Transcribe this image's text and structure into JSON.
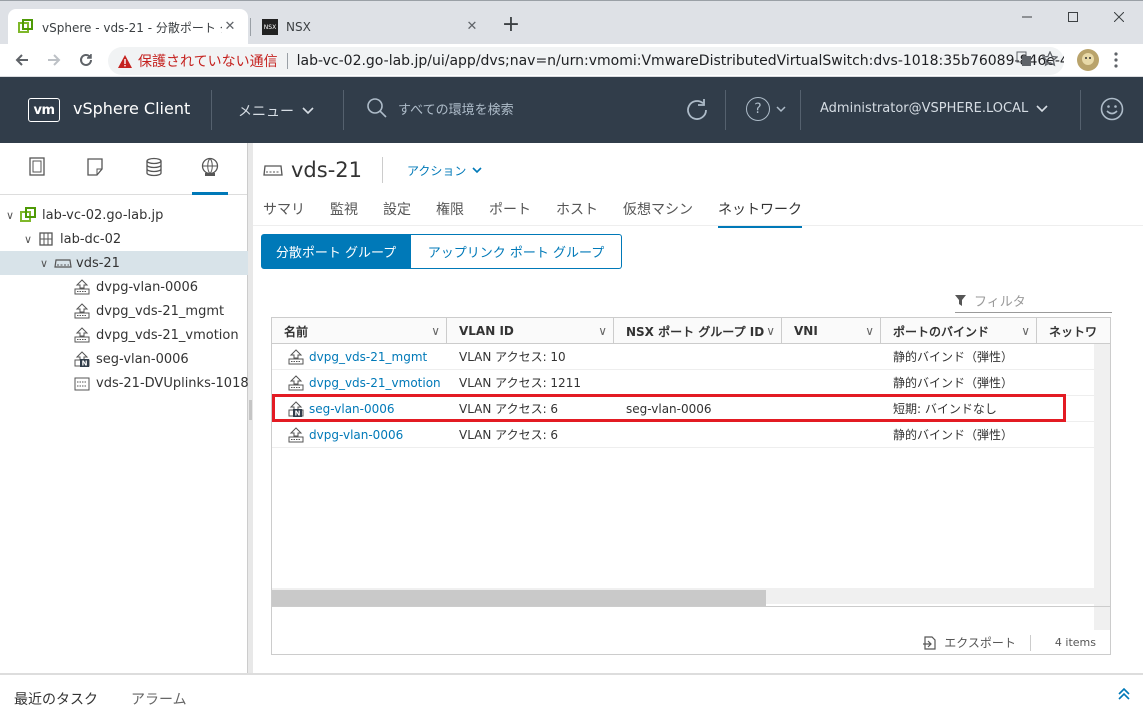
{
  "browser": {
    "tabs": [
      {
        "title": "vSphere - vds-21 - 分散ポート グル",
        "close": "✕"
      },
      {
        "title": "NSX",
        "close": "✕",
        "favicon_text": "NSX"
      }
    ],
    "new_tab": "+",
    "security_warning": "保護されていない通信",
    "url": "lab-vc-02.go-lab.jp/ui/app/dvs;nav=n/urn:vmomi:VmwareDistributedVirtualSwitch:dvs-1018:35b76089-846e-41ef..."
  },
  "header": {
    "logo": "vm",
    "app_title": "vSphere Client",
    "menu_label": "メニュー",
    "search_placeholder": "すべての環境を検索",
    "help_label": "?",
    "user": "Administrator@VSPHERE.LOCAL"
  },
  "nav": {
    "tree": [
      {
        "label": "lab-vc-02.go-lab.jp",
        "icon": "vcenter-icon"
      },
      {
        "label": "lab-dc-02",
        "icon": "datacenter-icon"
      },
      {
        "label": "vds-21",
        "icon": "dvswitch-icon"
      },
      {
        "label": "dvpg-vlan-0006",
        "icon": "portgroup-icon"
      },
      {
        "label": "dvpg_vds-21_mgmt",
        "icon": "portgroup-icon"
      },
      {
        "label": "dvpg_vds-21_vmotion",
        "icon": "portgroup-icon"
      },
      {
        "label": "seg-vlan-0006",
        "icon": "nsx-portgroup-icon"
      },
      {
        "label": "vds-21-DVUplinks-1018",
        "icon": "uplink-portgroup-icon"
      }
    ]
  },
  "main": {
    "object_title": "vds-21",
    "actions_label": "アクション",
    "tabs": [
      "サマリ",
      "監視",
      "設定",
      "権限",
      "ポート",
      "ホスト",
      "仮想マシン",
      "ネットワーク"
    ],
    "active_tab": "ネットワーク",
    "subtabs": [
      "分散ポート グループ",
      "アップリンク ポート グループ"
    ],
    "filter_placeholder": "フィルタ",
    "columns": [
      "名前",
      "VLAN ID",
      "NSX ポート グループ ID",
      "VNI",
      "ポートのバインド",
      "ネットワ"
    ],
    "rows": [
      {
        "name": "dvpg_vds-21_mgmt",
        "vlan": "VLAN アクセス: 10",
        "nsx_id": "",
        "vni": "",
        "binding": "静的バインド（弾性）",
        "icon": "portgroup-icon"
      },
      {
        "name": "dvpg_vds-21_vmotion",
        "vlan": "VLAN アクセス: 1211",
        "nsx_id": "",
        "vni": "",
        "binding": "静的バインド（弾性）",
        "icon": "portgroup-icon"
      },
      {
        "name": "seg-vlan-0006",
        "vlan": "VLAN アクセス: 6",
        "nsx_id": "seg-vlan-0006",
        "vni": "",
        "binding": "短期: バインドなし",
        "icon": "nsx-portgroup-icon"
      },
      {
        "name": "dvpg-vlan-0006",
        "vlan": "VLAN アクセス: 6",
        "nsx_id": "",
        "vni": "",
        "binding": "静的バインド（弾性）",
        "icon": "portgroup-icon"
      }
    ],
    "export_label": "エクスポート",
    "item_count": "4 items"
  },
  "bottom": {
    "tasks_label": "最近のタスク",
    "alarms_label": "アラーム"
  },
  "colors": {
    "header_bg": "#313d4a",
    "accent": "#0079b8",
    "highlight": "#e31b23",
    "selected_row": "#d8e3e9"
  }
}
